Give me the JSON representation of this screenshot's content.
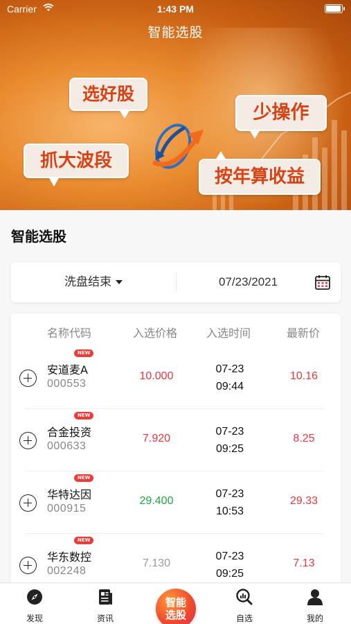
{
  "status_bar": {
    "carrier": "Carrier",
    "time": "1:43 PM"
  },
  "header": {
    "title": "智能选股"
  },
  "banner": {
    "bubbles": [
      "选好股",
      "抓大波段",
      "少操作",
      "按年算收益"
    ]
  },
  "section": {
    "title": "智能选股"
  },
  "filter": {
    "selected_option": "洗盘结束",
    "date": "07/23/2021"
  },
  "table": {
    "columns": [
      "名称代码",
      "入选价格",
      "入选时间",
      "最新价"
    ],
    "new_badge": "NEW",
    "rows": [
      {
        "name": "安道麦A",
        "code": "000553",
        "price": "10.000",
        "price_color": "#e8363c",
        "time_date": "07-23",
        "time_clock": "09:44",
        "latest": "10.16",
        "latest_color": "#e8363c"
      },
      {
        "name": "合金投资",
        "code": "000633",
        "price": "7.920",
        "price_color": "#e8363c",
        "time_date": "07-23",
        "time_clock": "09:25",
        "latest": "8.25",
        "latest_color": "#e8363c"
      },
      {
        "name": "华特达因",
        "code": "000915",
        "price": "29.400",
        "price_color": "#1fa63c",
        "time_date": "07-23",
        "time_clock": "10:53",
        "latest": "29.33",
        "latest_color": "#e8363c"
      },
      {
        "name": "华东数控",
        "code": "002248",
        "price": "7.130",
        "price_color": "#999999",
        "time_date": "07-23",
        "time_clock": "09:25",
        "latest": "7.13",
        "latest_color": "#e8363c"
      }
    ]
  },
  "tabbar": {
    "items": [
      {
        "label": "发现",
        "icon": "compass-icon"
      },
      {
        "label": "资讯",
        "icon": "news-icon"
      },
      {
        "label": "智能选股",
        "icon": "smart-pick-icon",
        "line1": "智能",
        "line2": "选股"
      },
      {
        "label": "自选",
        "icon": "watchlist-icon"
      },
      {
        "label": "我的",
        "icon": "profile-icon"
      }
    ]
  }
}
